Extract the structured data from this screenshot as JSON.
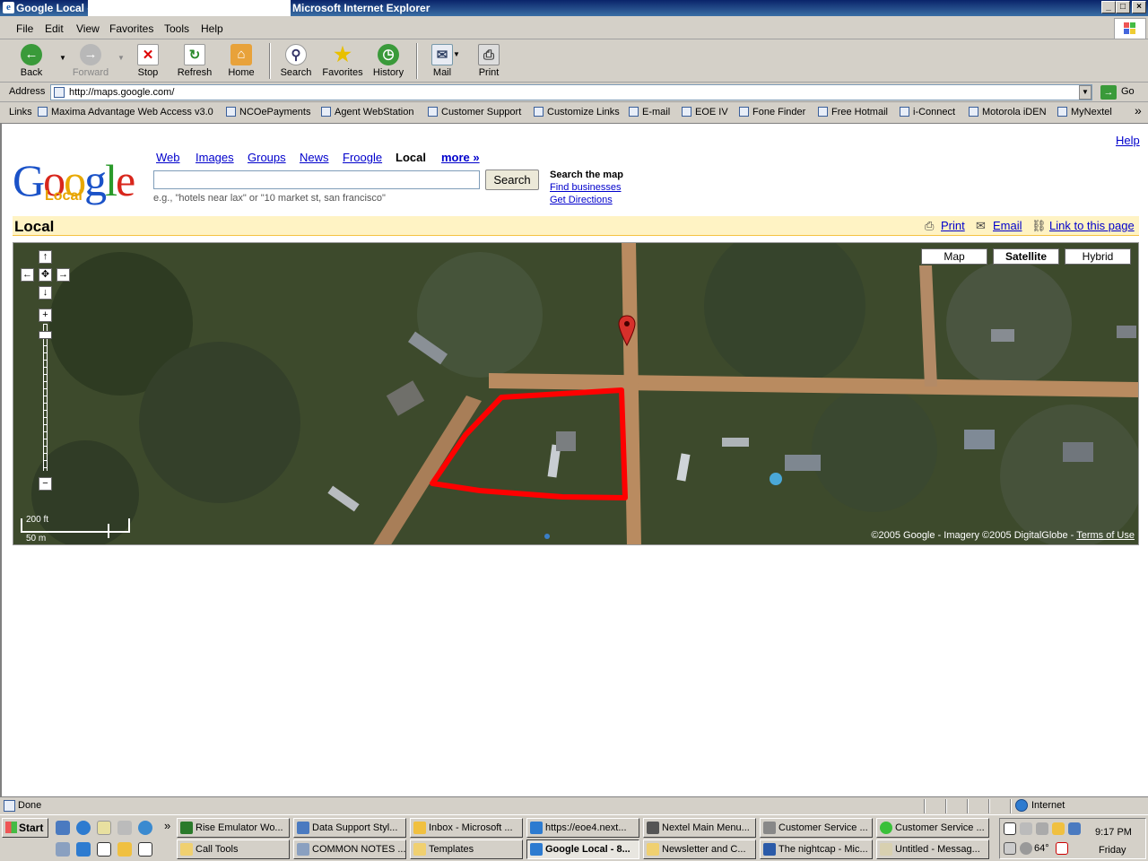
{
  "window": {
    "title_left": "Google Local -",
    "title_right": "Microsoft Internet Explorer",
    "controls": [
      "_",
      "□",
      "×"
    ]
  },
  "menu": [
    "File",
    "Edit",
    "View",
    "Favorites",
    "Tools",
    "Help"
  ],
  "toolbar": {
    "back": "Back",
    "forward": "Forward",
    "stop": "Stop",
    "refresh": "Refresh",
    "home": "Home",
    "search": "Search",
    "favorites": "Favorites",
    "history": "History",
    "mail": "Mail",
    "print": "Print"
  },
  "address": {
    "label": "Address",
    "url": "http://maps.google.com/",
    "go": "Go"
  },
  "links": {
    "label": "Links",
    "items": [
      "Maxima Advantage Web Access v3.0",
      "NCOePayments",
      "Agent WebStation",
      "Customer Support",
      "Customize Links",
      "E-mail",
      "EOE IV",
      "Fone Finder",
      "Free Hotmail",
      "i-Connect",
      "Motorola iDEN",
      "MyNextel"
    ],
    "more": "»"
  },
  "page": {
    "help": "Help",
    "logo": "Google",
    "logo_sub": "Local",
    "nav": [
      "Web",
      "Images",
      "Groups",
      "News",
      "Froogle",
      "Local",
      "more »"
    ],
    "search_value": "",
    "search_button": "Search",
    "hint": "e.g., \"hotels near lax\" or \"10 market st, san francisco\"",
    "search_the_map": "Search the map",
    "find_businesses": "Find businesses",
    "get_directions": "Get Directions",
    "section_title": "Local",
    "actions": {
      "print": "Print",
      "email": "Email",
      "link": "Link to this page"
    }
  },
  "map": {
    "types": [
      "Map",
      "Satellite",
      "Hybrid"
    ],
    "selected_type": "Satellite",
    "scale_ft": "200 ft",
    "scale_m": "50 m",
    "copyright": "©2005 Google - Imagery ©2005 DigitalGlobe -",
    "terms": "Terms of Use",
    "marker_color": "#d6302b",
    "outline_color": "#ff0000"
  },
  "status": {
    "text": "Done",
    "zone": "Internet"
  },
  "taskbar": {
    "start": "Start",
    "row1": [
      "Rise Emulator Wo...",
      "Data Support Styl...",
      "Inbox - Microsoft ...",
      "https://eoe4.next...",
      "Nextel Main Menu...",
      "Customer Service ...",
      "Customer Service ..."
    ],
    "row2": [
      "Call Tools",
      "COMMON NOTES ...",
      "Templates",
      "Google Local - 8...",
      "Newsletter and C...",
      "The nightcap - Mic...",
      "Untitled - Messag..."
    ],
    "chevron": "»",
    "time": "9:17 PM",
    "day": "Friday",
    "temp": "64°"
  }
}
